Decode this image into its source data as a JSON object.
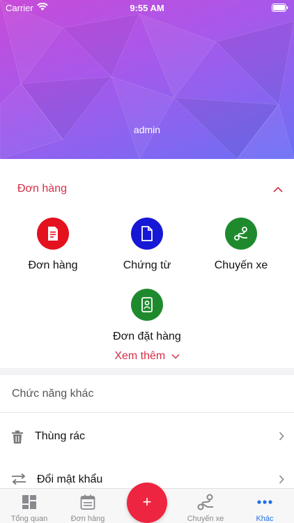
{
  "status_bar": {
    "carrier": "Carrier",
    "time": "9:55 AM"
  },
  "hero": {
    "username": "admin"
  },
  "orders_section": {
    "title": "Đơn hàng",
    "items": [
      {
        "label": "Đơn hàng",
        "icon": "order-document-icon",
        "color": "#e4111e"
      },
      {
        "label": "Chứng từ",
        "icon": "voucher-file-icon",
        "color": "#1717d6"
      },
      {
        "label": "Chuyến xe",
        "icon": "route-icon",
        "color": "#1f8a2d"
      },
      {
        "label": "Đơn đặt hàng",
        "icon": "purchase-order-icon",
        "color": "#1f8a2d"
      }
    ],
    "see_more": "Xem thêm"
  },
  "other_section": {
    "title": "Chức năng khác",
    "items": [
      {
        "label": "Thùng rác",
        "icon": "trash-icon"
      },
      {
        "label": "Đổi mật khẩu",
        "icon": "swap-arrows-icon"
      }
    ]
  },
  "tab_bar": {
    "tabs": [
      {
        "label": "Tổng quan",
        "icon": "dashboard-icon"
      },
      {
        "label": "Đơn hàng",
        "icon": "calendar-list-icon"
      },
      {
        "label": "Chuyến xe",
        "icon": "route-icon"
      },
      {
        "label": "Khác",
        "icon": "more-dots-icon"
      }
    ],
    "active": "Khác",
    "fab_label": "+"
  },
  "colors": {
    "accent_red": "#d62d46",
    "active_tab": "#1e6fe6",
    "fab": "#ee2541"
  }
}
